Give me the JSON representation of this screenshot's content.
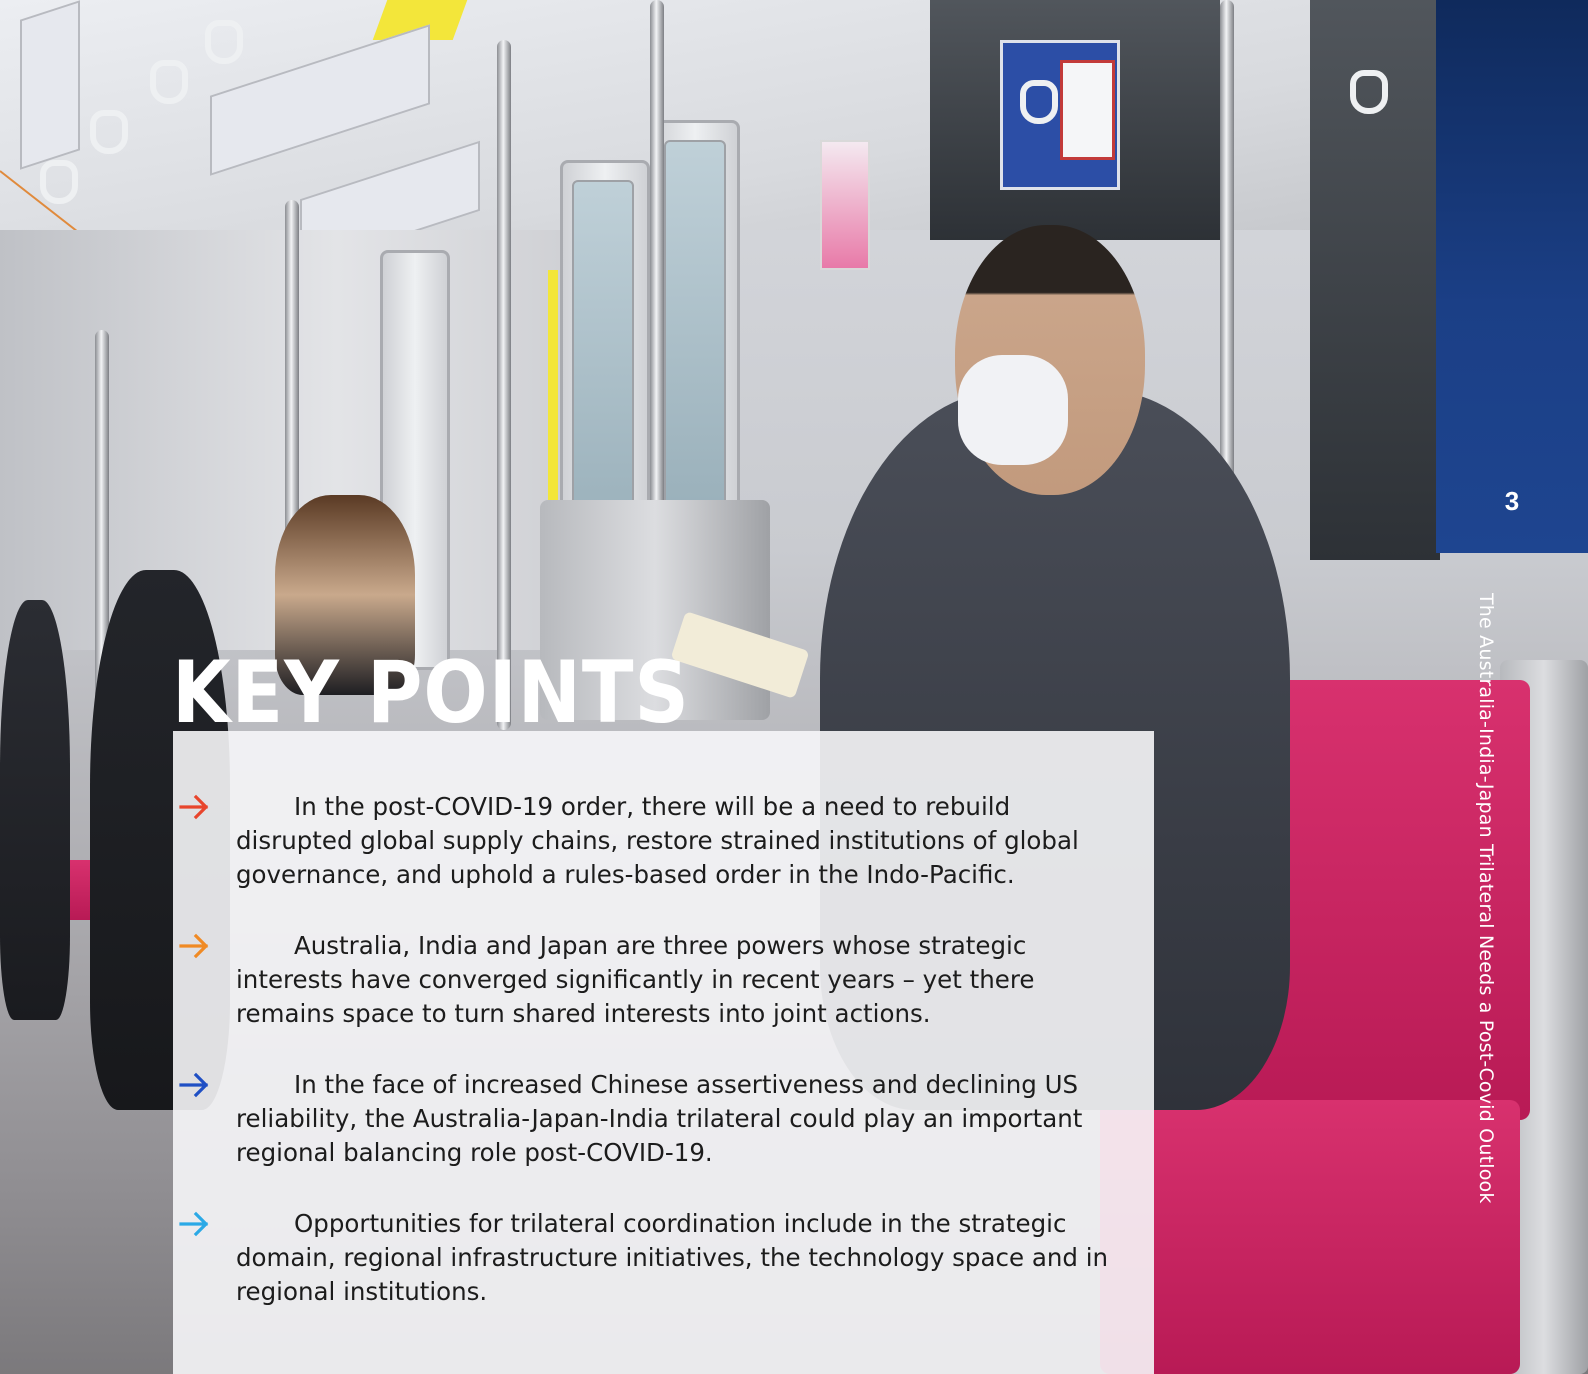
{
  "page": {
    "number": "3",
    "running_title": "The Australia-India-Japan Trilateral Needs a Post-Covid Outlook"
  },
  "section": {
    "heading": "KEY POINTS"
  },
  "key_points": [
    {
      "text": "In the post-COVID-19 order, there will be a need to rebuild disrupted global supply chains, restore strained institutions of global governance, and uphold a rules-based order in the Indo-Pacific.",
      "arrow_color": "#e8452c",
      "arrow_icon": "right-arrow-icon"
    },
    {
      "text": "Australia, India and Japan are three powers whose strategic interests have converged significantly in recent years – yet there remains space to turn shared interests into joint actions.",
      "arrow_color": "#f08a24",
      "arrow_icon": "right-arrow-icon"
    },
    {
      "text": "In the face of increased Chinese assertiveness and declining US reliability, the Australia-Japan-India trilateral could play an important regional balancing role post-COVID-19.",
      "arrow_color": "#1f4fc4",
      "arrow_icon": "right-arrow-icon"
    },
    {
      "text": "Opportunities for trilateral coordination include in the strategic domain, regional infrastructure initiatives, the technology space and in regional institutions.",
      "arrow_color": "#2ba9e6",
      "arrow_icon": "right-arrow-icon"
    }
  ],
  "colors": {
    "side_tab": "#1b3f86",
    "panel": "#f6f6f8",
    "text": "#1c1c1c"
  }
}
